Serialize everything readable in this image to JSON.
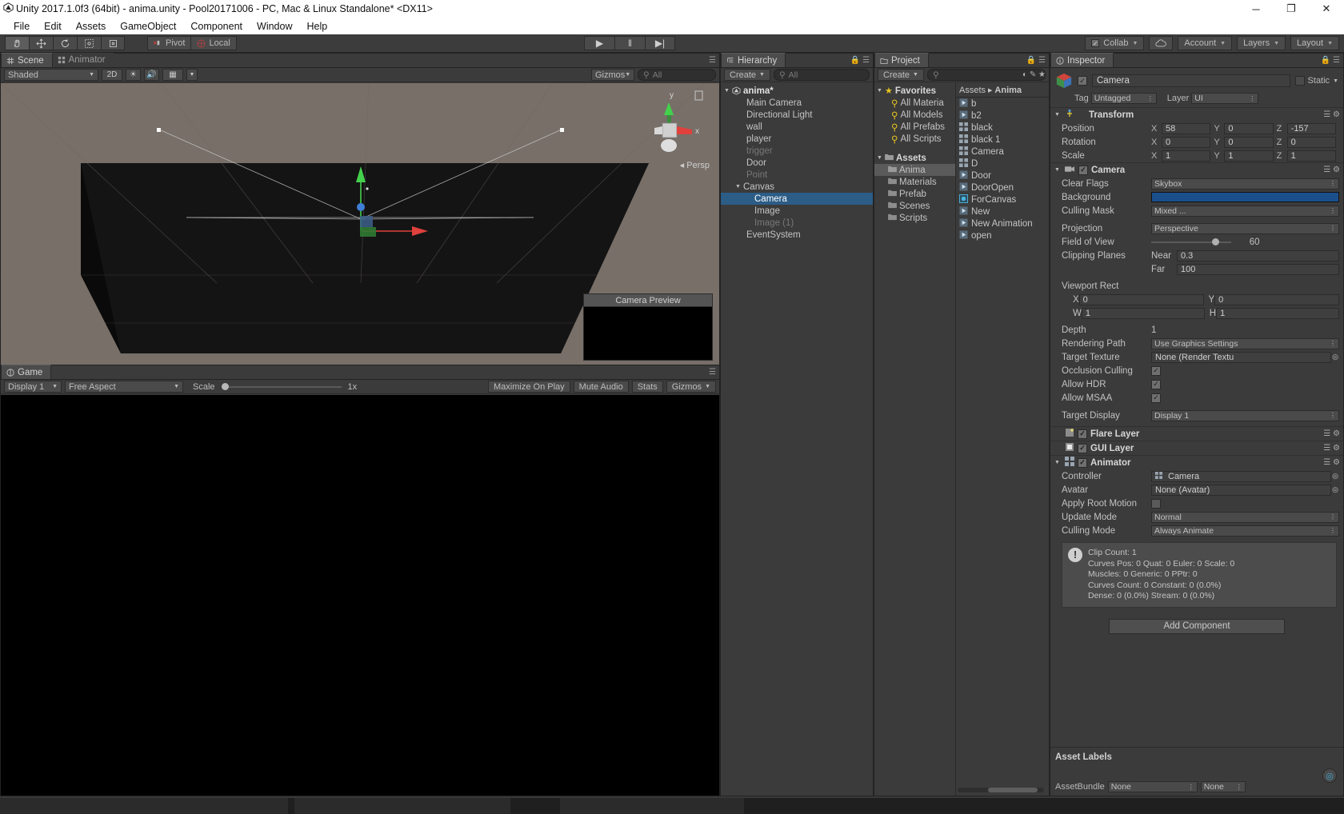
{
  "window": {
    "title": "Unity 2017.1.0f3 (64bit) - anima.unity - Pool20171006 - PC, Mac & Linux Standalone* <DX11>",
    "minimize": "─",
    "maximize": "❐",
    "close": "✕"
  },
  "menu": [
    "File",
    "Edit",
    "Assets",
    "GameObject",
    "Component",
    "Window",
    "Help"
  ],
  "toolbar": {
    "tools": [
      "hand-tool",
      "move-tool",
      "rotate-tool",
      "scale-tool",
      "rect-tool"
    ],
    "pivot": "Pivot",
    "local": "Local",
    "play": "▶",
    "pause": "‖",
    "step": "▶|",
    "collab": "Collab",
    "cloud": "cloud-icon",
    "account": "Account",
    "layers": "Layers",
    "layout": "Layout"
  },
  "scene": {
    "tabs": [
      {
        "label": "Scene",
        "active": true
      },
      {
        "label": "Animator",
        "active": false
      }
    ],
    "draw_mode": "Shaded",
    "two_d": "2D",
    "gizmos": "Gizmos",
    "search_placeholder": "All",
    "persp_label": "Persp",
    "axis_y": "y",
    "axis_x": "x",
    "camera_preview_title": "Camera Preview"
  },
  "game": {
    "tab": "Game",
    "display": "Display 1",
    "aspect": "Free Aspect",
    "scale_label": "Scale",
    "scale_value": "1x",
    "maximize": "Maximize On Play",
    "mute": "Mute Audio",
    "stats": "Stats",
    "gizmos": "Gizmos"
  },
  "hierarchy": {
    "tab": "Hierarchy",
    "create": "Create",
    "search_placeholder": "All",
    "items": [
      {
        "label": "anima*",
        "indent": 0,
        "dim": false,
        "sel": false,
        "arrow": true,
        "icon": "unity-scene-icon",
        "bold": true
      },
      {
        "label": "Main Camera",
        "indent": 1,
        "dim": false,
        "sel": false
      },
      {
        "label": "Directional Light",
        "indent": 1,
        "dim": false,
        "sel": false
      },
      {
        "label": "wall",
        "indent": 1,
        "dim": false,
        "sel": false
      },
      {
        "label": "player",
        "indent": 1,
        "dim": false,
        "sel": false
      },
      {
        "label": "trigger",
        "indent": 1,
        "dim": true,
        "sel": false
      },
      {
        "label": "Door",
        "indent": 1,
        "dim": false,
        "sel": false
      },
      {
        "label": "Point",
        "indent": 1,
        "dim": true,
        "sel": false
      },
      {
        "label": "Canvas",
        "indent": 1,
        "dim": false,
        "sel": false,
        "arrow": true
      },
      {
        "label": "Camera",
        "indent": 2,
        "dim": false,
        "sel": true
      },
      {
        "label": "Image",
        "indent": 2,
        "dim": false,
        "sel": false
      },
      {
        "label": "Image (1)",
        "indent": 2,
        "dim": true,
        "sel": false
      },
      {
        "label": "EventSystem",
        "indent": 1,
        "dim": false,
        "sel": false
      }
    ]
  },
  "project": {
    "tab": "Project",
    "create": "Create",
    "search_placeholder": "",
    "favorites_label": "Favorites",
    "favorites": [
      "All Materia",
      "All Models",
      "All Prefabs",
      "All Scripts"
    ],
    "assets_label": "Assets",
    "folders": [
      {
        "label": "Anima",
        "sel": true
      },
      {
        "label": "Materials",
        "sel": false
      },
      {
        "label": "Prefab",
        "sel": false
      },
      {
        "label": "Scenes",
        "sel": false
      },
      {
        "label": "Scripts",
        "sel": false
      }
    ],
    "breadcrumb_root": "Assets",
    "breadcrumb_current": "Anima",
    "assets": [
      {
        "label": "b",
        "icon": "animation-clip-icon"
      },
      {
        "label": "b2",
        "icon": "animation-clip-icon"
      },
      {
        "label": "black",
        "icon": "animator-controller-icon"
      },
      {
        "label": "black 1",
        "icon": "animator-controller-icon"
      },
      {
        "label": "Camera",
        "icon": "animator-controller-icon"
      },
      {
        "label": "D",
        "icon": "animator-controller-icon"
      },
      {
        "label": "Door",
        "icon": "animation-clip-icon"
      },
      {
        "label": "DoorOpen",
        "icon": "animation-clip-icon"
      },
      {
        "label": "ForCanvas",
        "icon": "prefab-icon"
      },
      {
        "label": "New",
        "icon": "animation-clip-icon"
      },
      {
        "label": "New Animation",
        "icon": "animation-clip-icon"
      },
      {
        "label": "open",
        "icon": "animation-clip-icon"
      }
    ]
  },
  "inspector": {
    "tab": "Inspector",
    "object_name": "Camera",
    "object_enabled": true,
    "static_label": "Static",
    "tag_label": "Tag",
    "tag_value": "Untagged",
    "layer_label": "Layer",
    "layer_value": "UI",
    "transform": {
      "title": "Transform",
      "rows": [
        {
          "label": "Position",
          "x": "58",
          "y": "0",
          "z": "-157"
        },
        {
          "label": "Rotation",
          "x": "0",
          "y": "0",
          "z": "0"
        },
        {
          "label": "Scale",
          "x": "1",
          "y": "1",
          "z": "1"
        }
      ]
    },
    "camera": {
      "title": "Camera",
      "enabled": true,
      "clear_flags_label": "Clear Flags",
      "clear_flags_value": "Skybox",
      "background_label": "Background",
      "background_color": "#1b4f8c",
      "culling_mask_label": "Culling Mask",
      "culling_mask_value": "Mixed ...",
      "projection_label": "Projection",
      "projection_value": "Perspective",
      "fov_label": "Field of View",
      "fov_value": "60",
      "clipping_label": "Clipping Planes",
      "near_label": "Near",
      "near_value": "0.3",
      "far_label": "Far",
      "far_value": "100",
      "viewport_label": "Viewport Rect",
      "viewport_x_label": "X",
      "viewport_x": "0",
      "viewport_y_label": "Y",
      "viewport_y": "0",
      "viewport_w_label": "W",
      "viewport_w": "1",
      "viewport_h_label": "H",
      "viewport_h": "1",
      "depth_label": "Depth",
      "depth_value": "1",
      "rendering_path_label": "Rendering Path",
      "rendering_path_value": "Use Graphics Settings",
      "target_texture_label": "Target Texture",
      "target_texture_value": "None (Render Textu",
      "occlusion_label": "Occlusion Culling",
      "occlusion_checked": true,
      "hdr_label": "Allow HDR",
      "hdr_checked": true,
      "msaa_label": "Allow MSAA",
      "msaa_checked": true,
      "target_display_label": "Target Display",
      "target_display_value": "Display 1"
    },
    "flare_layer": {
      "title": "Flare Layer",
      "enabled": true
    },
    "gui_layer": {
      "title": "GUI Layer",
      "enabled": true
    },
    "animator": {
      "title": "Animator",
      "enabled": true,
      "controller_label": "Controller",
      "controller_value": "Camera",
      "avatar_label": "Avatar",
      "avatar_value": "None (Avatar)",
      "apply_root_label": "Apply Root Motion",
      "apply_root_checked": false,
      "update_mode_label": "Update Mode",
      "update_mode_value": "Normal",
      "culling_mode_label": "Culling Mode",
      "culling_mode_value": "Always Animate",
      "info_lines": [
        "Clip Count: 1",
        "Curves Pos: 0 Quat: 0 Euler: 0 Scale: 0",
        "Muscles: 0 Generic: 0 PPtr: 0",
        "Curves Count: 0 Constant: 0 (0.0%)",
        "Dense: 0 (0.0%) Stream: 0 (0.0%)"
      ]
    },
    "add_component": "Add Component",
    "asset_labels_title": "Asset Labels",
    "assetbundle_label": "AssetBundle",
    "assetbundle_value": "None",
    "assetbundle_variant": "None"
  },
  "colors": {
    "panel_bg": "#3b3b3b",
    "selection_blue": "#2c5d87",
    "scene_bg": "#776f68",
    "accent_yellow": "#e8c51f"
  }
}
